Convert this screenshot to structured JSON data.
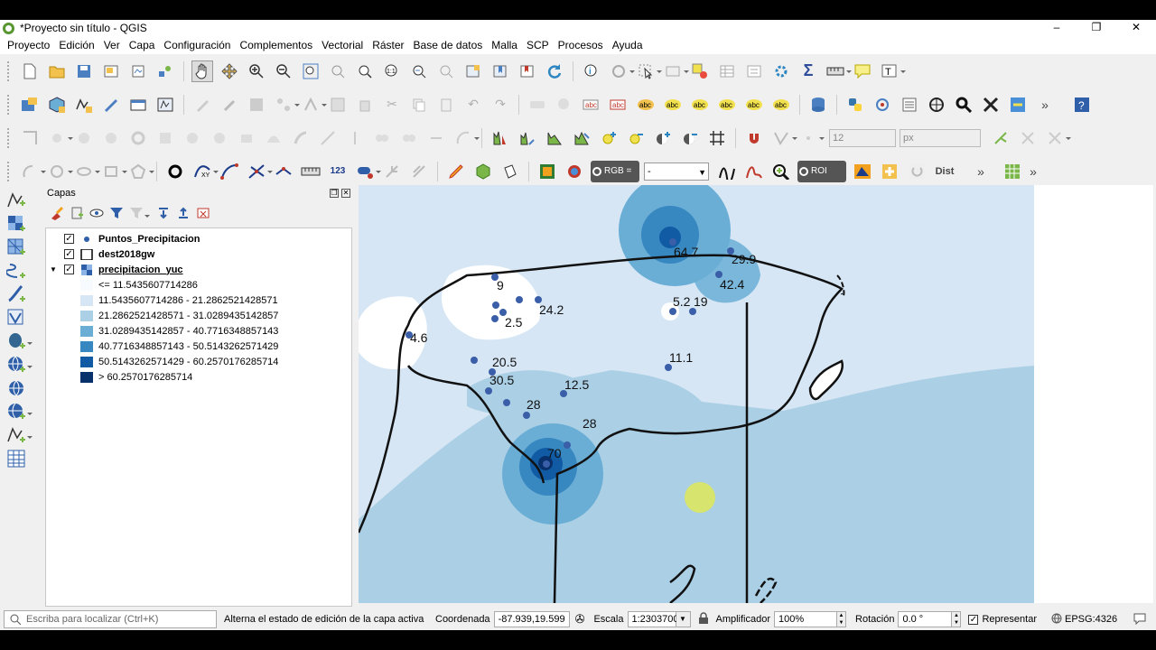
{
  "window": {
    "title": "*Proyecto sin título - QGIS",
    "controls": {
      "minimize": "–",
      "restore": "❐",
      "close": "✕"
    }
  },
  "menu": [
    "Proyecto",
    "Edición",
    "Ver",
    "Capa",
    "Configuración",
    "Complementos",
    "Vectorial",
    "Ráster",
    "Base de datos",
    "Malla",
    "SCP",
    "Procesos",
    "Ayuda"
  ],
  "toolbars": {
    "label_size": "12",
    "label_unit": "px",
    "scp_rgb_label": "RGB =",
    "scp_rgb_value": "-",
    "scp_roi_label": "ROI",
    "scp_dist_label": "Dist",
    "more": "»"
  },
  "layers_panel": {
    "title": "Capas",
    "layers": [
      {
        "name": "Puntos_Precipitacion",
        "checked": true
      },
      {
        "name": "dest2018gw",
        "checked": true
      },
      {
        "name": "precipitacion_yuc",
        "checked": true
      }
    ],
    "legend": [
      {
        "label": "<= 11.5435607714286",
        "color": "#f7fbff"
      },
      {
        "label": "11.5435607714286 - 21.2862521428571",
        "color": "#d6e6f4"
      },
      {
        "label": "21.2862521428571 - 31.0289435142857",
        "color": "#abcfe5"
      },
      {
        "label": "31.0289435142857 - 40.7716348857143",
        "color": "#6aaed6"
      },
      {
        "label": "40.7716348857143 - 50.5143262571429",
        "color": "#3787c0"
      },
      {
        "label": "50.5143262571429 - 60.2570176285714",
        "color": "#105ba4"
      },
      {
        "label": "> 60.2570176285714",
        "color": "#08306b"
      }
    ]
  },
  "map_labels": [
    {
      "text": "64.7"
    },
    {
      "text": "29.9"
    },
    {
      "text": "42.4"
    },
    {
      "text": "9"
    },
    {
      "text": "24.2"
    },
    {
      "text": "2.5"
    },
    {
      "text": "5.2"
    },
    {
      "text": "19"
    },
    {
      "text": "4.6"
    },
    {
      "text": "20.5"
    },
    {
      "text": "11.1"
    },
    {
      "text": "30.5"
    },
    {
      "text": "12.5"
    },
    {
      "text": "28"
    },
    {
      "text": "28"
    },
    {
      "text": "70"
    }
  ],
  "statusbar": {
    "search_placeholder": "Escriba para localizar (Ctrl+K)",
    "message": "Alterna el estado de edición de la capa activa",
    "coord_label": "Coordenada",
    "coord_value": "-87.939,19.599",
    "scale_label": "Escala",
    "scale_value": "1:2303700",
    "magnifier_label": "Amplificador",
    "magnifier_value": "100%",
    "rotation_label": "Rotación",
    "rotation_value": "0.0 °",
    "render_label": "Representar",
    "crs": "EPSG:4326"
  }
}
